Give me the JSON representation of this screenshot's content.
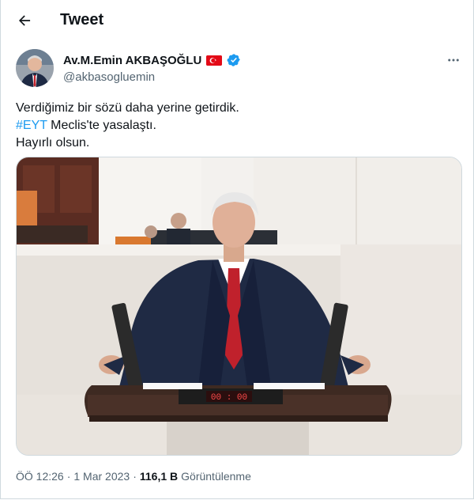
{
  "header": {
    "title": "Tweet"
  },
  "author": {
    "name": "Av.M.Emin AKBAŞOĞLU",
    "handle": "@akbasogluemin"
  },
  "tweet": {
    "line1": "Verdiğimiz bir sözü daha yerine getirdik.",
    "hashtag": "#EYT",
    "line2_rest": " Meclis'te yasalaştı.",
    "line3": "Hayırlı olsun."
  },
  "media": {
    "counter_display": "00 : 00"
  },
  "meta": {
    "time": "ÖÖ 12:26",
    "sep1": "·",
    "date": "1 Mar 2023",
    "sep2": "·",
    "views_count": "116,1 B",
    "views_label": "Görüntülenme"
  },
  "icons": {
    "back": "arrow-left-icon",
    "flag": "turkish-flag-icon",
    "verified": "verified-badge-icon",
    "more": "more-horizontal-icon"
  },
  "colors": {
    "accent": "#1d9bf0",
    "text_primary": "#0f1419",
    "text_secondary": "#536471",
    "border": "#cfd9de"
  }
}
